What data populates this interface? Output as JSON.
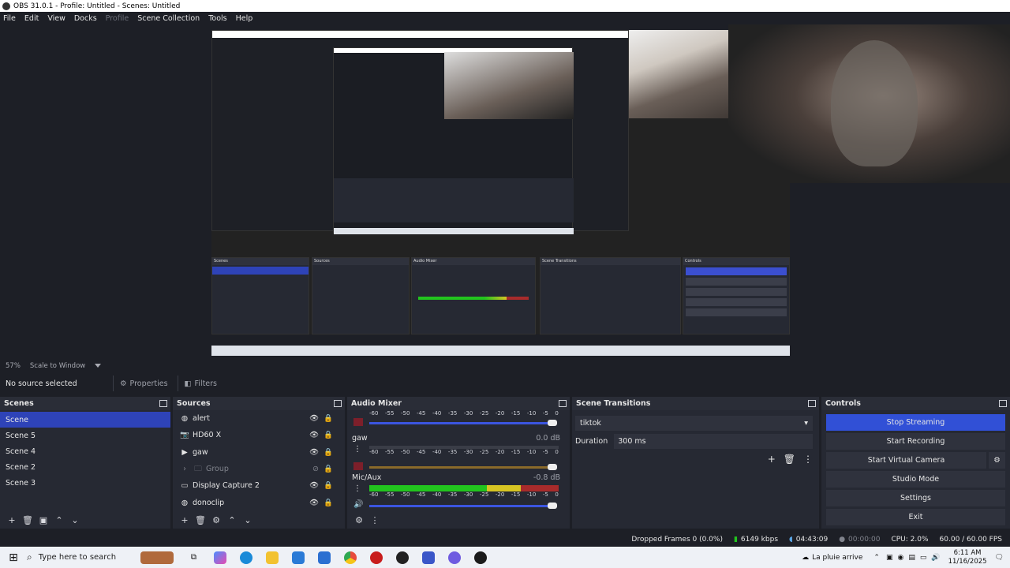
{
  "window": {
    "title": "OBS 31.0.1 - Profile: Untitled - Scenes: Untitled"
  },
  "menu": [
    "File",
    "Edit",
    "View",
    "Docks",
    "Profile",
    "Scene Collection",
    "Tools",
    "Help"
  ],
  "zoom": {
    "percent": "57%",
    "mode": "Scale to Window"
  },
  "selection": {
    "status": "No source selected",
    "properties": "Properties",
    "filters": "Filters"
  },
  "scenes": {
    "title": "Scenes",
    "items": [
      "Scene",
      "Scene 5",
      "Scene 4",
      "Scene 2",
      "Scene 3"
    ],
    "selected_index": 0
  },
  "sources": {
    "title": "Sources",
    "items": [
      {
        "name": "alert",
        "icon": "browser-icon"
      },
      {
        "name": "HD60 X",
        "icon": "camera-icon"
      },
      {
        "name": "gaw",
        "icon": "media-play-icon"
      },
      {
        "name": "Group",
        "icon": "folder-icon"
      },
      {
        "name": "Display Capture 2",
        "icon": "monitor-icon"
      },
      {
        "name": "donoclip",
        "icon": "browser-icon"
      }
    ]
  },
  "mixer": {
    "title": "Audio Mixer",
    "ticks": [
      "-60",
      "-55",
      "-50",
      "-45",
      "-40",
      "-35",
      "-30",
      "-25",
      "-20",
      "-15",
      "-10",
      "-5",
      "0"
    ],
    "channels": [
      {
        "name": "",
        "db": ""
      },
      {
        "name": "gaw",
        "db": "0.0 dB"
      },
      {
        "name": "Mic/Aux",
        "db": "-0.8 dB"
      }
    ]
  },
  "transitions": {
    "title": "Scene Transitions",
    "selected": "tiktok",
    "duration_label": "Duration",
    "duration_value": "300 ms"
  },
  "controls": {
    "title": "Controls",
    "buttons": [
      "Stop Streaming",
      "Start Recording",
      "Start Virtual Camera",
      "Studio Mode",
      "Settings",
      "Exit"
    ]
  },
  "status": {
    "dropped": "Dropped Frames 0 (0.0%)",
    "bitrate": "6149 kbps",
    "stream_time": "04:43:09",
    "rec_time": "00:00:00",
    "cpu": "CPU: 2.0%",
    "fps": "60.00 / 60.00 FPS"
  },
  "taskbar": {
    "search_placeholder": "Type here to search",
    "weather": "La pluie arrive",
    "time": "6:11 AM",
    "date": "11/16/2025"
  },
  "colors": {
    "accent": "#3150d6",
    "selected_row": "#2e43b8",
    "meter_green": "#22c41e",
    "meter_yellow": "#d7c423",
    "meter_red": "#a82b2b"
  }
}
